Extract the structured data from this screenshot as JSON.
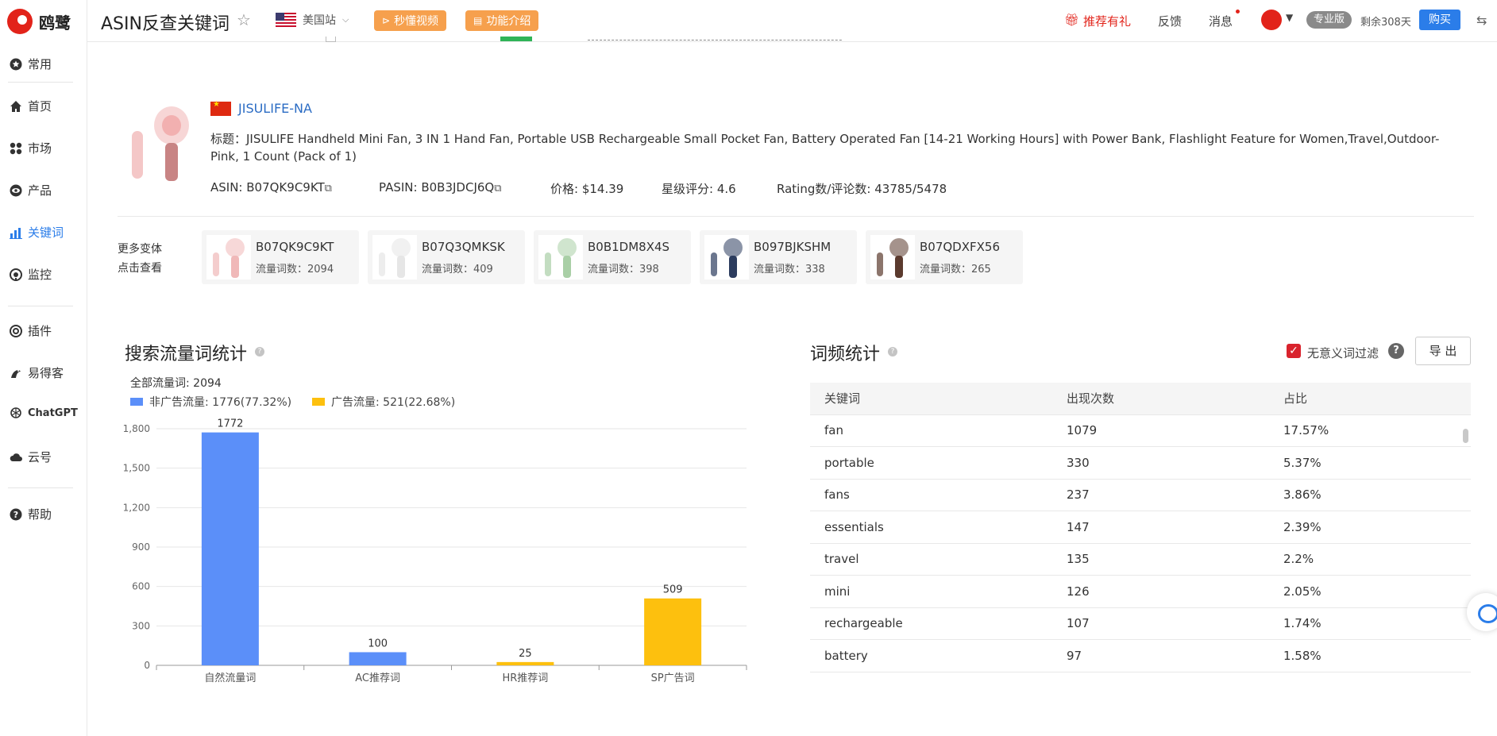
{
  "app": {
    "brand": "鸥鹭",
    "page_title": "ASIN反查关键词"
  },
  "sidebar": {
    "items": [
      {
        "label": "常用",
        "icon": "star-circle-icon"
      },
      {
        "label": "首页",
        "icon": "home-icon"
      },
      {
        "label": "市场",
        "icon": "grid-icon"
      },
      {
        "label": "产品",
        "icon": "eye-icon"
      },
      {
        "label": "关键词",
        "icon": "bar-chart-icon",
        "active": true
      },
      {
        "label": "监控",
        "icon": "monitor-icon"
      },
      {
        "label": "插件",
        "icon": "chrome-icon"
      },
      {
        "label": "易得客",
        "icon": "bird-icon"
      },
      {
        "label": "ChatGPT",
        "icon": "openai-icon"
      },
      {
        "label": "云号",
        "icon": "cloud-icon"
      },
      {
        "label": "帮助",
        "icon": "help-icon"
      }
    ]
  },
  "header": {
    "site": "美国站",
    "video_btn": "秒懂视频",
    "intro_btn": "功能介绍",
    "recommend": "推荐有礼",
    "feedback": "反馈",
    "messages": "消息",
    "plan": "专业版",
    "remaining": "剩余308天",
    "buy": "购买"
  },
  "product": {
    "store": "JISULIFE-NA",
    "title": "标题：JISULIFE Handheld Mini Fan, 3 IN 1 Hand Fan, Portable USB Rechargeable Small Pocket Fan, Battery Operated Fan [14-21 Working Hours] with Power Bank, Flashlight Feature for Women,Travel,Outdoor-Pink, 1 Count (Pack of 1)",
    "asin": "ASIN: B07QK9C9KT",
    "pasin": "PASIN: B0B3JDCJ6Q",
    "price": "价格: $14.39",
    "rating": "星级评分: 4.6",
    "reviews": "Rating数/评论数: 43785/5478",
    "variants_label_1": "更多变体",
    "variants_label_2": "点击查看",
    "variants": [
      {
        "asin": "B07QK9C9KT",
        "count": "流量词数：2094",
        "color": "#f0b8b8"
      },
      {
        "asin": "B07Q3QMKSK",
        "count": "流量词数：409",
        "color": "#e6e6e6"
      },
      {
        "asin": "B0B1DM8X4S",
        "count": "流量词数：398",
        "color": "#a9cfa6"
      },
      {
        "asin": "B097BJKSHM",
        "count": "流量词数：338",
        "color": "#2c3c5e"
      },
      {
        "asin": "B07QDXFX56",
        "count": "流量词数：265",
        "color": "#5b3a2e"
      }
    ]
  },
  "traffic": {
    "title": "搜索流量词统计",
    "total": "全部流量词: 2094",
    "legend_organic": "非广告流量: 1776(77.32%)",
    "legend_ad": "广告流量: 521(22.68%)",
    "color_organic": "#5b8ff9",
    "color_ad": "#fdc00e"
  },
  "chart_data": {
    "type": "bar",
    "title": "搜索流量词统计",
    "categories": [
      "自然流量词",
      "AC推荐词",
      "HR推荐词",
      "SP广告词"
    ],
    "values": [
      1772,
      100,
      25,
      509
    ],
    "colors": [
      "#5b8ff9",
      "#5b8ff9",
      "#fdc00e",
      "#fdc00e"
    ],
    "ylim": [
      0,
      1800
    ],
    "yticks": [
      0,
      300,
      600,
      900,
      1200,
      1500,
      1800
    ],
    "ytick_labels": [
      "0",
      "300",
      "600",
      "900",
      "1,200",
      "1,500",
      "1,800"
    ],
    "grid": true
  },
  "wordfreq": {
    "title": "词频统计",
    "filter_label": "无意义词过滤",
    "export": "导 出",
    "columns": [
      "关键词",
      "出现次数",
      "占比"
    ],
    "rows": [
      [
        "fan",
        "1079",
        "17.57%"
      ],
      [
        "portable",
        "330",
        "5.37%"
      ],
      [
        "fans",
        "237",
        "3.86%"
      ],
      [
        "essentials",
        "147",
        "2.39%"
      ],
      [
        "travel",
        "135",
        "2.2%"
      ],
      [
        "mini",
        "126",
        "2.05%"
      ],
      [
        "rechargeable",
        "107",
        "1.74%"
      ],
      [
        "battery",
        "97",
        "1.58%"
      ]
    ]
  }
}
